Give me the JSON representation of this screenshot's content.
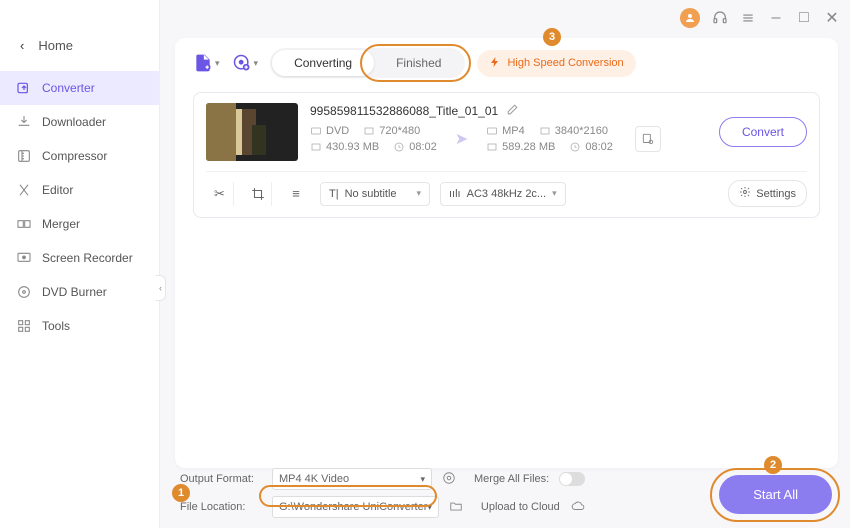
{
  "titlebar": {
    "min": "–",
    "max": "□",
    "close": "✕"
  },
  "sidebar": {
    "home": "Home",
    "items": [
      {
        "label": "Converter",
        "icon": "convert"
      },
      {
        "label": "Downloader",
        "icon": "download"
      },
      {
        "label": "Compressor",
        "icon": "compress"
      },
      {
        "label": "Editor",
        "icon": "editor"
      },
      {
        "label": "Merger",
        "icon": "merger"
      },
      {
        "label": "Screen Recorder",
        "icon": "screenrec"
      },
      {
        "label": "DVD Burner",
        "icon": "dvd"
      },
      {
        "label": "Tools",
        "icon": "tools"
      }
    ]
  },
  "toolbar": {
    "tabs": {
      "converting": "Converting",
      "finished": "Finished"
    },
    "high_speed": "High Speed Conversion"
  },
  "file": {
    "title": "995859811532886088_Title_01_01",
    "src": {
      "container": "DVD",
      "res": "720*480",
      "size": "430.93 MB",
      "dur": "08:02"
    },
    "dst": {
      "container": "MP4",
      "res": "3840*2160",
      "size": "589.28 MB",
      "dur": "08:02"
    },
    "convert_label": "Convert",
    "subtitle": "No subtitle",
    "audio": "AC3 48kHz 2c...",
    "settings_label": "Settings"
  },
  "footer": {
    "output_format_label": "Output Format:",
    "output_format_value": "MP4 4K Video",
    "merge_label": "Merge All Files:",
    "file_location_label": "File Location:",
    "file_location_value": "G:\\Wondershare UniConverter ",
    "upload_label": "Upload to Cloud",
    "start_all": "Start All"
  },
  "callouts": {
    "1": "1",
    "2": "2",
    "3": "3"
  }
}
